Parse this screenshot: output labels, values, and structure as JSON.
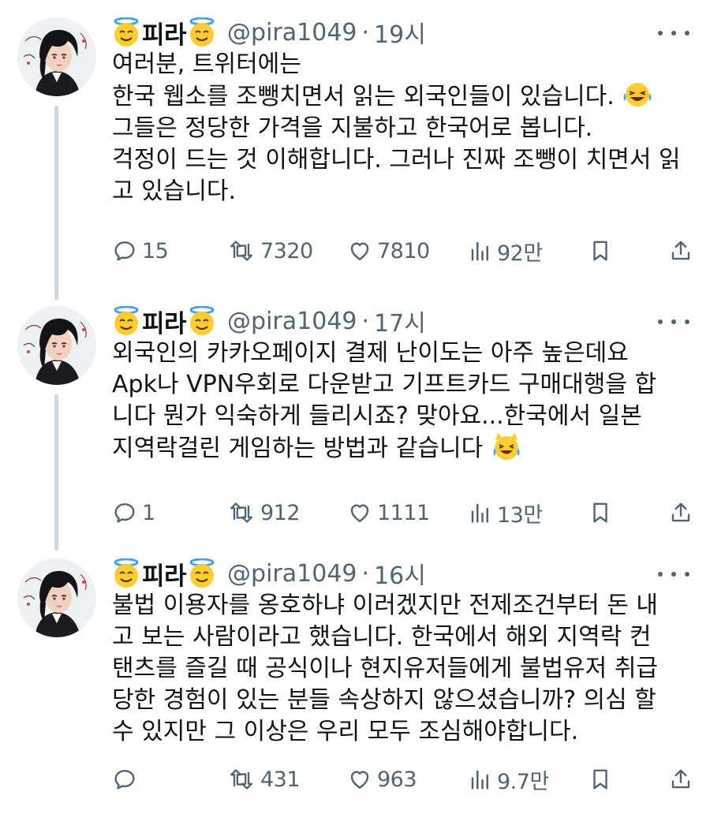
{
  "tweets": [
    {
      "display_name": "피라",
      "handle": "@pira1049",
      "separator": "·",
      "time": "19시",
      "lines": [
        "여러분, 트위터에는",
        "한국 웹소를 조뺑치면서 읽는 외국인들이 있습니다.",
        "그들은 정당한 가격을 지불하고 한국어로 봅니다.",
        "걱정이 드는 것 이해합니다. 그러나 진짜 조뺑이 치면서 읽",
        "고 있습니다."
      ],
      "emoji_after_line": 1,
      "emoji_name": "tears-of-joy-emoji",
      "replies": "15",
      "reposts": "7320",
      "likes": "7810",
      "views": "92만"
    },
    {
      "display_name": "피라",
      "handle": "@pira1049",
      "separator": "·",
      "time": "17시",
      "lines": [
        "외국인의 카카오페이지 결제 난이도는 아주 높은데요",
        "Apk나 VPN우회로 다운받고 기프트카드 구매대행을 합",
        "니다 뭔가 익숙하게 들리시죠? 맞아요...한국에서 일본",
        "지역락걸린 게임하는 방법과 같습니다"
      ],
      "emoji_after_line": 3,
      "emoji_name": "cat-tears-of-joy-emoji",
      "replies": "1",
      "reposts": "912",
      "likes": "1111",
      "views": "13만"
    },
    {
      "display_name": "피라",
      "handle": "@pira1049",
      "separator": "·",
      "time": "16시",
      "lines": [
        "불법 이용자를 옹호하냐 이러겠지만 전제조건부터 돈 내",
        "고 보는 사람이라고 했습니다. 한국에서 해외 지역락 컨",
        "탠츠를 즐길 때 공식이나 현지유저들에게 불법유저 취급",
        "당한 경험이 있는 분들 속상하지 않으셨습니까? 의심 할",
        "수 있지만 그 이상은 우리 모두 조심해야합니다."
      ],
      "emoji_after_line": -1,
      "emoji_name": "",
      "replies": "",
      "reposts": "431",
      "likes": "963",
      "views": "9.7만"
    }
  ],
  "colors": {
    "text": "#0f1419",
    "secondary": "#536471",
    "thread_line": "#cfd9de"
  }
}
